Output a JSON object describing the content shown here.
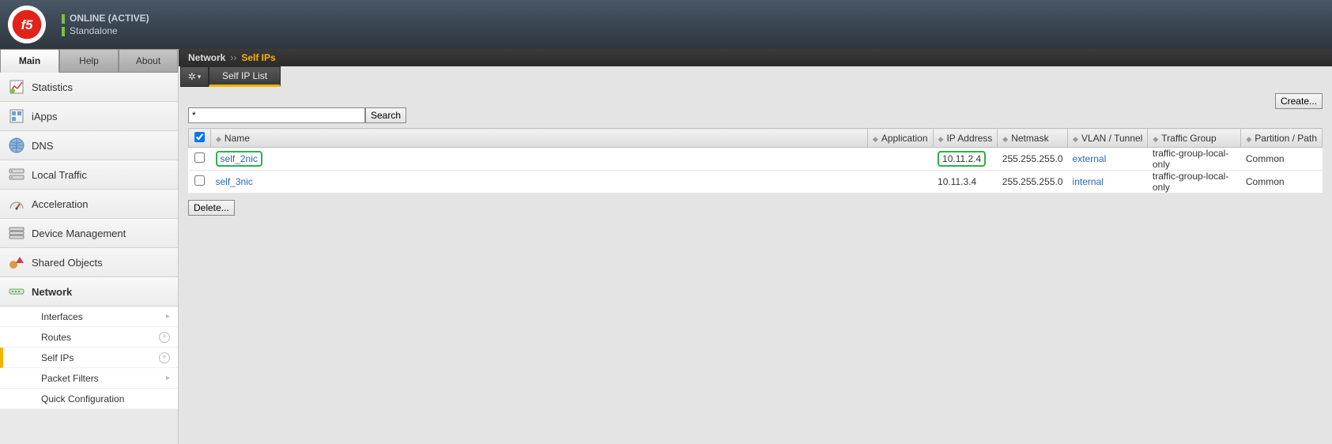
{
  "header": {
    "status1": "ONLINE (ACTIVE)",
    "status2": "Standalone"
  },
  "top_tabs": {
    "main": "Main",
    "help": "Help",
    "about": "About"
  },
  "nav": {
    "statistics": "Statistics",
    "iapps": "iApps",
    "dns": "DNS",
    "local_traffic": "Local Traffic",
    "acceleration": "Acceleration",
    "device_mgmt": "Device Management",
    "shared_objects": "Shared Objects",
    "network": "Network"
  },
  "subnav": {
    "interfaces": "Interfaces",
    "routes": "Routes",
    "self_ips": "Self IPs",
    "packet_filters": "Packet Filters",
    "quick_config": "Quick Configuration"
  },
  "breadcrumb": {
    "section": "Network",
    "page": "Self IPs"
  },
  "subtab": {
    "label": "Self IP List"
  },
  "search": {
    "value": "*",
    "button": "Search"
  },
  "create_button": "Create...",
  "columns": {
    "name": "Name",
    "application": "Application",
    "ip_address": "IP Address",
    "netmask": "Netmask",
    "vlan_tunnel": "VLAN / Tunnel",
    "traffic_group": "Traffic Group",
    "partition_path": "Partition / Path"
  },
  "rows": [
    {
      "name": "self_2nic",
      "application": "",
      "ip": "10.11.2.4",
      "netmask": "255.255.255.0",
      "vlan": "external",
      "tg": "traffic-group-local-only",
      "partition": "Common",
      "highlight": true
    },
    {
      "name": "self_3nic",
      "application": "",
      "ip": "10.11.3.4",
      "netmask": "255.255.255.0",
      "vlan": "internal",
      "tg": "traffic-group-local-only",
      "partition": "Common",
      "highlight": false
    }
  ],
  "delete_button": "Delete..."
}
